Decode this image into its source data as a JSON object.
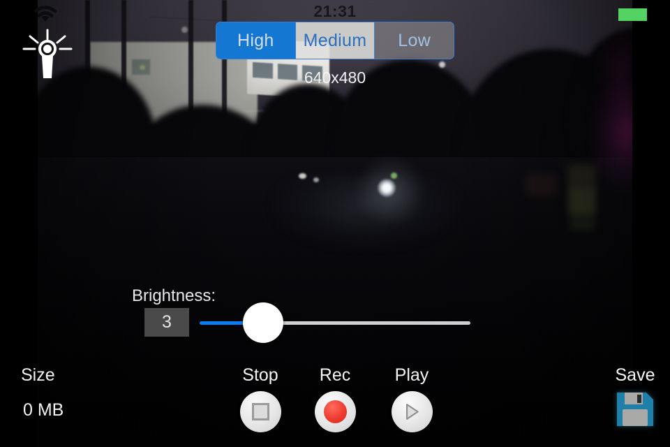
{
  "status_bar": {
    "clock": "21:31",
    "battery_icon": "battery-full-indicator",
    "wifi_icon": "wifi-icon"
  },
  "torch": {
    "icon": "flashlight-icon"
  },
  "quality": {
    "options": [
      {
        "label": "High",
        "selected": true
      },
      {
        "label": "Medium",
        "selected": false
      },
      {
        "label": "Low",
        "selected": false
      }
    ],
    "selected_value": "High",
    "selected_color": "#1477d1"
  },
  "resolution": {
    "label": "640x480"
  },
  "brightness": {
    "label": "Brightness:",
    "value": "3",
    "fill_color": "#0a7cf4",
    "track_color": "#cfcfcf"
  },
  "size": {
    "label": "Size",
    "value": "0 MB"
  },
  "transport": {
    "stop": {
      "label": "Stop",
      "icon": "stop-square-icon"
    },
    "rec": {
      "label": "Rec",
      "icon": "record-dot-icon",
      "color": "#ef3b30"
    },
    "play": {
      "label": "Play",
      "icon": "play-triangle-icon"
    }
  },
  "save": {
    "label": "Save",
    "icon": "floppy-disk-icon",
    "color": "#1f7fa8"
  }
}
